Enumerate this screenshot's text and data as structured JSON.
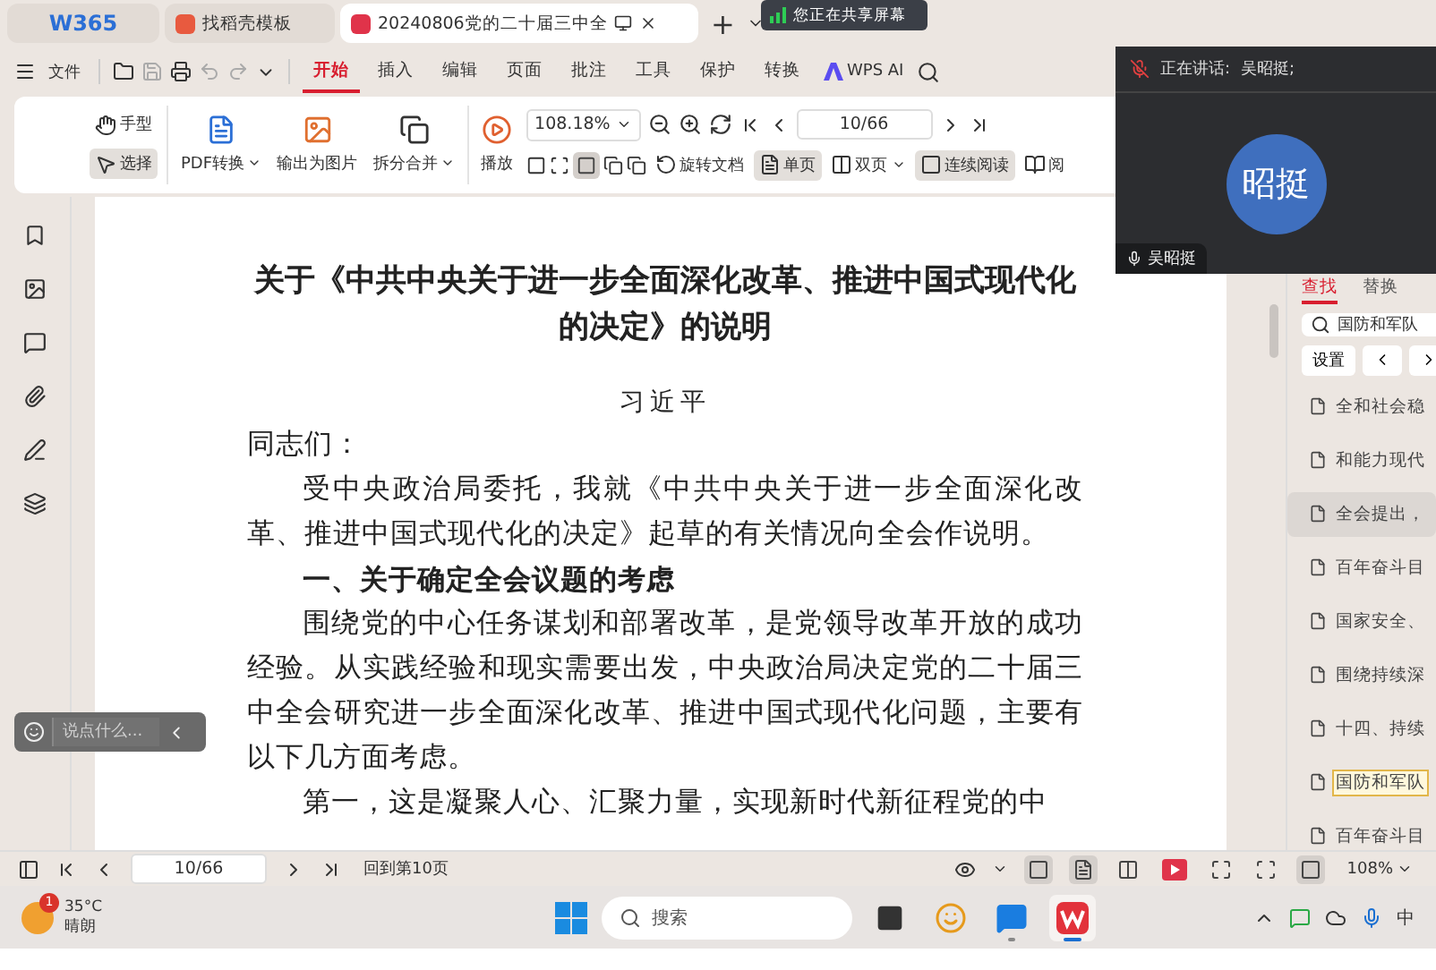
{
  "tab_bar": {
    "tabs": [
      {
        "kind": "logo",
        "label": "W365",
        "selected": false
      },
      {
        "kind": "page",
        "label": "找稻壳模板",
        "selected": false
      },
      {
        "kind": "doc",
        "label": "20240806党的二十届三中全",
        "selected": true
      }
    ],
    "new_tab": "+"
  },
  "share_banner": "您正在共享屏幕",
  "menu": {
    "file": "文件",
    "tabs": [
      {
        "label": "开始",
        "selected": true
      },
      {
        "label": "插入",
        "selected": false
      },
      {
        "label": "编辑",
        "selected": false
      },
      {
        "label": "页面",
        "selected": false
      },
      {
        "label": "批注",
        "selected": false
      },
      {
        "label": "工具",
        "selected": false
      },
      {
        "label": "保护",
        "selected": false
      },
      {
        "label": "转换",
        "selected": false
      }
    ],
    "ai": "WPS AI"
  },
  "toolbar": {
    "pointers": [
      {
        "kind": "hand",
        "label": "手型",
        "selected": false
      },
      {
        "kind": "select",
        "label": "选择",
        "selected": true
      }
    ],
    "tools": [
      {
        "kind": "pdf",
        "label": "PDF转换",
        "dropdown": true
      },
      {
        "kind": "image",
        "label": "输出为图片",
        "dropdown": false
      },
      {
        "kind": "split",
        "label": "拆分合并",
        "dropdown": true
      },
      {
        "kind": "play",
        "label": "播放",
        "dropdown": false
      }
    ],
    "zoom": "108.18%",
    "page": "10/66",
    "views": [
      {
        "kind": "rotate",
        "label": "旋转文档",
        "selected": false,
        "dropdown": false
      },
      {
        "kind": "single",
        "label": "单页",
        "selected": true,
        "dropdown": false
      },
      {
        "kind": "double",
        "label": "双页",
        "selected": false,
        "dropdown": true
      },
      {
        "kind": "continuous",
        "label": "连续阅读",
        "selected": true,
        "dropdown": false
      },
      {
        "kind": "read",
        "label": "阅",
        "selected": false,
        "dropdown": false
      }
    ]
  },
  "document": {
    "title": "关于《中共中央关于进一步全面深化改革、推进中国式现代化的决定》的说明",
    "author": "习近平",
    "blocks": [
      {
        "kind": "salutation",
        "text": "同志们："
      },
      {
        "kind": "paragraph",
        "text": "受中央政治局委托，我就《中共中央关于进一步全面深化改革、推进中国式现代化的决定》起草的有关情况向全会作说明。"
      },
      {
        "kind": "heading",
        "text": "一、关于确定全会议题的考虑"
      },
      {
        "kind": "paragraph",
        "text": "围绕党的中心任务谋划和部署改革，是党领导改革开放的成功经验。从实践经验和现实需要出发，中央政治局决定党的二十届三中全会研究进一步全面深化改革、推进中国式现代化问题，主要有以下几方面考虑。"
      },
      {
        "kind": "paragraph",
        "text": "第一，这是凝聚人心、汇聚力量，实现新时代新征程党的中"
      }
    ]
  },
  "chat": {
    "placeholder": "说点什么..."
  },
  "video": {
    "speaking_label": "正在讲话:",
    "speaker": "吴昭挺;",
    "avatar": "昭挺",
    "name": "吴昭挺"
  },
  "find_panel": {
    "tabs": [
      {
        "label": "查找",
        "selected": true
      },
      {
        "label": "替换",
        "selected": false
      }
    ],
    "query": "国防和军队",
    "settings": "设置",
    "results": [
      {
        "text": "全和社会稳",
        "selected": false,
        "highlighted": false
      },
      {
        "text": "和能力现代",
        "selected": false,
        "highlighted": false
      },
      {
        "text": "全会提出，",
        "selected": true,
        "highlighted": false
      },
      {
        "text": "百年奋斗目",
        "selected": false,
        "highlighted": false
      },
      {
        "text": "国家安全、",
        "selected": false,
        "highlighted": false
      },
      {
        "text": "围绕持续深",
        "selected": false,
        "highlighted": false
      },
      {
        "text": "十四、持续",
        "selected": false,
        "highlighted": false
      },
      {
        "text": "国防和军队",
        "selected": false,
        "highlighted": true
      },
      {
        "text": "百年奋斗目",
        "selected": false,
        "highlighted": false
      }
    ]
  },
  "status_bar": {
    "page": "10/66",
    "back_link": "回到第10页",
    "zoom": "108%",
    "views": [
      {
        "kind": "continuous",
        "selected": true
      },
      {
        "kind": "single",
        "selected": true
      },
      {
        "kind": "double",
        "selected": false
      },
      {
        "kind": "play",
        "selected": false
      },
      {
        "kind": "fit",
        "selected": false
      },
      {
        "kind": "full",
        "selected": false
      },
      {
        "kind": "width",
        "selected": true
      }
    ]
  },
  "taskbar": {
    "weather": {
      "badge": "1",
      "temp": "35°C",
      "condition": "晴朗"
    },
    "search_placeholder": "搜索",
    "apps": [
      {
        "kind": "taskview",
        "running": false,
        "active": false
      },
      {
        "kind": "penguin",
        "running": false,
        "active": false
      },
      {
        "kind": "chat",
        "running": true,
        "active": false
      },
      {
        "kind": "wps",
        "running": true,
        "active": true
      }
    ],
    "ime": "中"
  }
}
